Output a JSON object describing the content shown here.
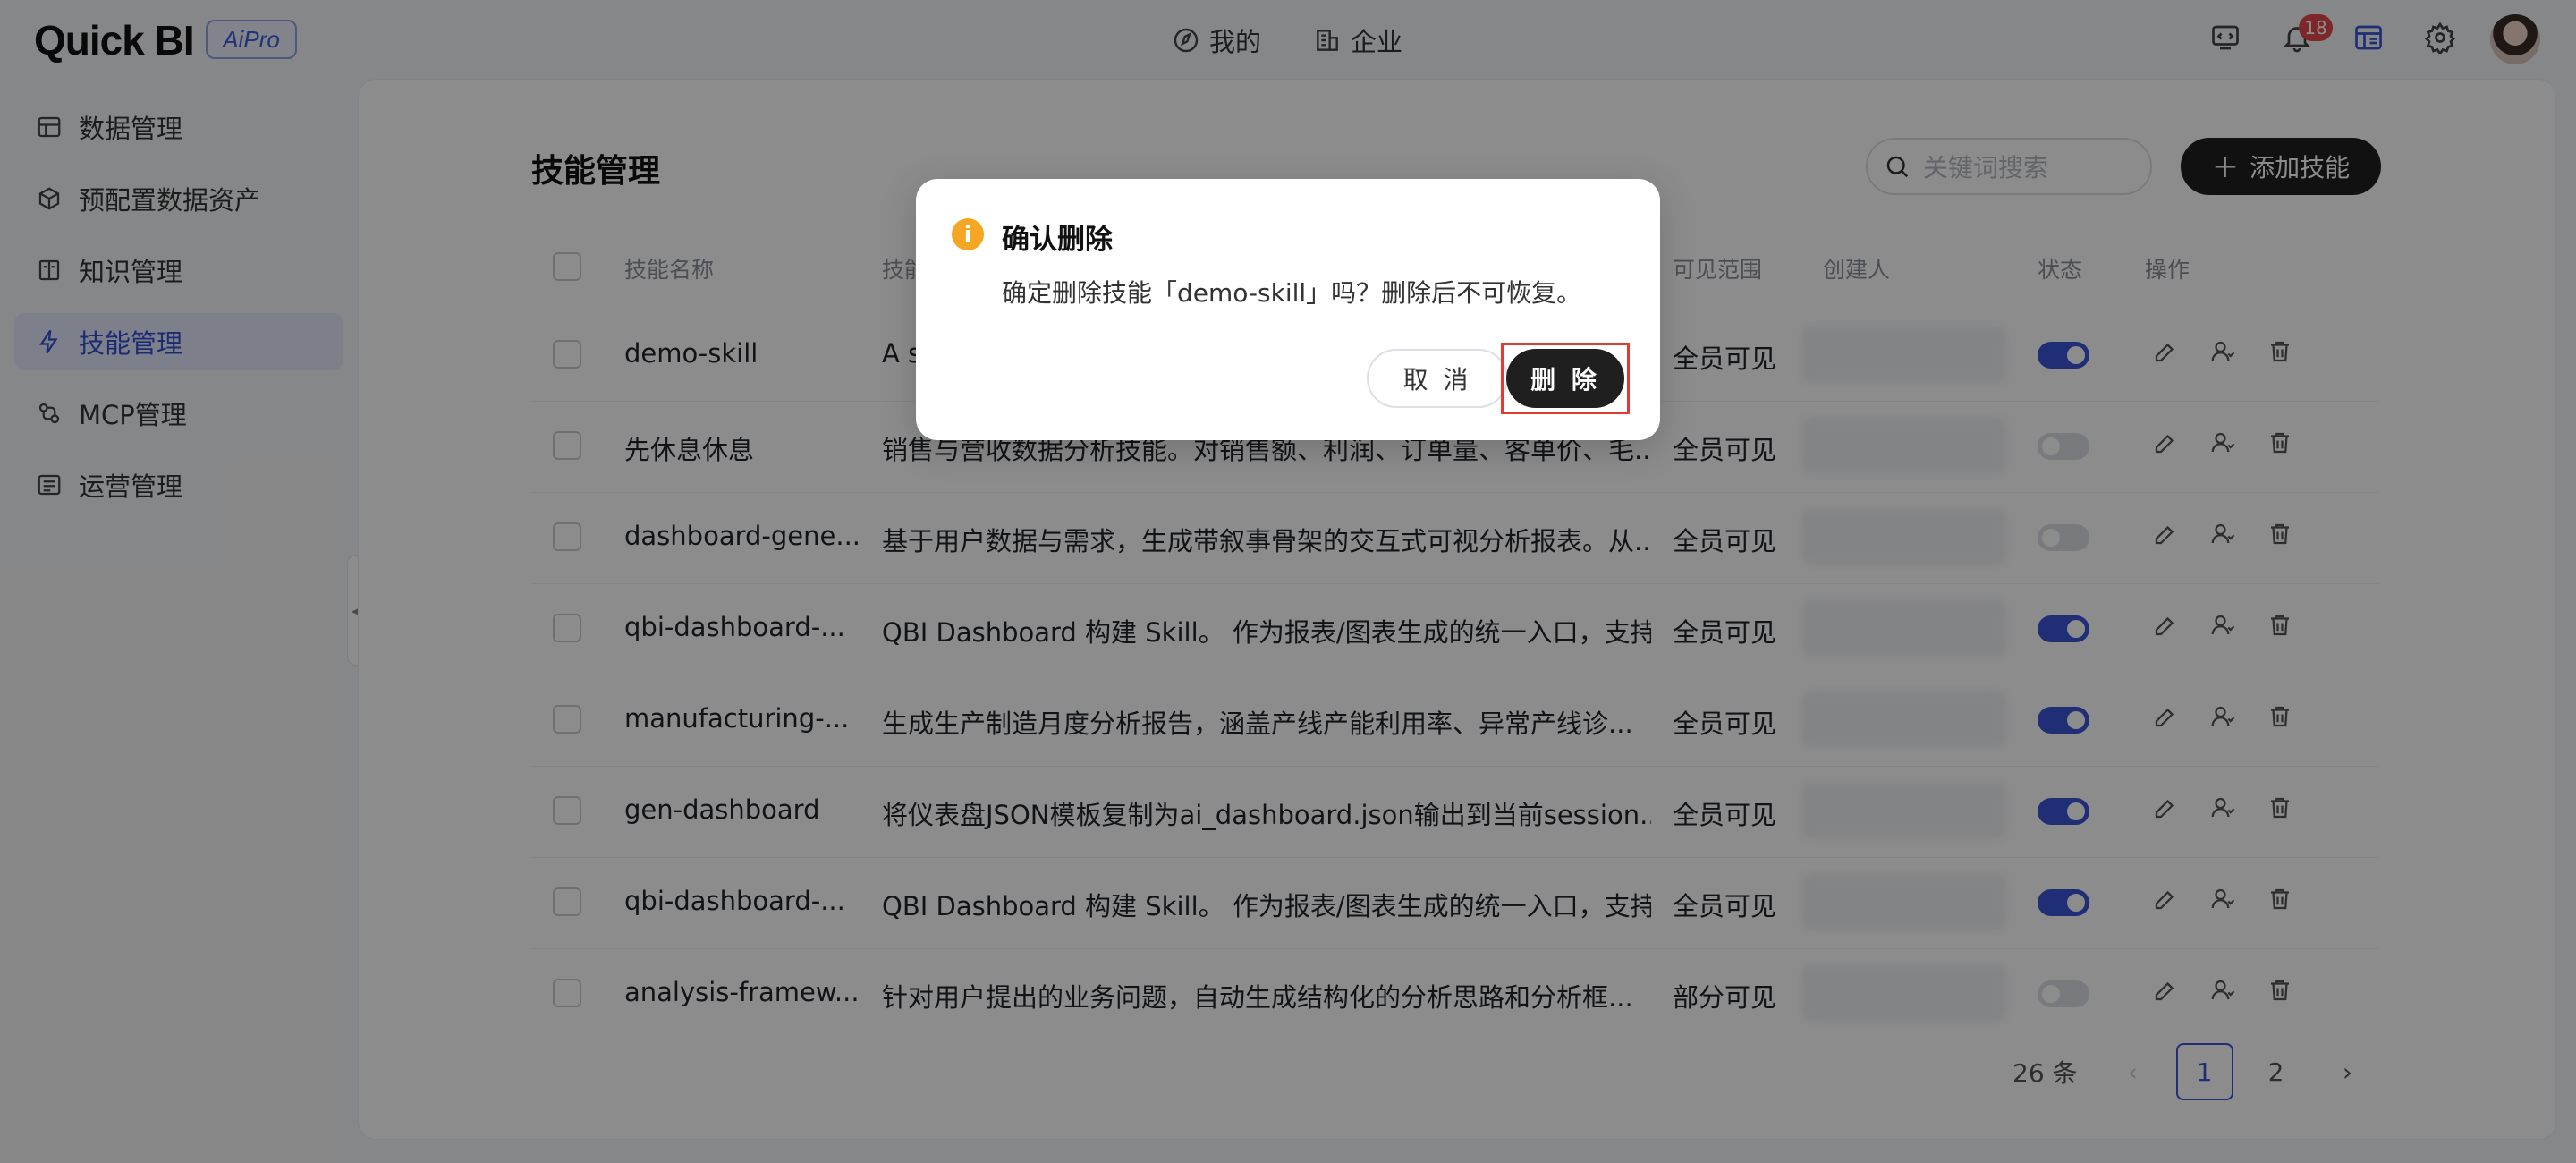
{
  "app": {
    "logo": "Quick BI",
    "badge": "AiPro"
  },
  "topnav": {
    "mine": "我的",
    "enterprise": "企业"
  },
  "notifications": {
    "count": "18"
  },
  "sidebar": {
    "items": [
      {
        "label": "数据管理",
        "icon": "data-table-icon"
      },
      {
        "label": "预配置数据资产",
        "icon": "cube-icon"
      },
      {
        "label": "知识管理",
        "icon": "book-icon"
      },
      {
        "label": "技能管理",
        "icon": "lightning-icon",
        "active": true
      },
      {
        "label": "MCP管理",
        "icon": "plug-icon"
      },
      {
        "label": "运营管理",
        "icon": "list-icon"
      }
    ]
  },
  "page": {
    "title": "技能管理",
    "search_placeholder": "关键词搜索",
    "add_button": "添加技能"
  },
  "table": {
    "headers": {
      "name": "技能名称",
      "desc": "技能描述",
      "scope": "可见范围",
      "creator": "创建人",
      "status": "状态",
      "actions": "操作"
    },
    "rows": [
      {
        "name": "demo-skill",
        "desc": "A s",
        "scope": "全员可见",
        "enabled": true
      },
      {
        "name": "先休息休息",
        "desc": "销售与营收数据分析技能。对销售额、利润、订单量、客单价、毛...",
        "scope": "全员可见",
        "enabled": false
      },
      {
        "name": "dashboard-gene...",
        "desc": "基于用户数据与需求，生成带叙事骨架的交互式可视分析报表。从...",
        "scope": "全员可见",
        "enabled": false
      },
      {
        "name": "qbi-dashboard-...",
        "desc": "QBI Dashboard 构建 Skill。 作为报表/图表生成的统一入口，支持...",
        "scope": "全员可见",
        "enabled": true
      },
      {
        "name": "manufacturing-...",
        "desc": "生成生产制造月度分析报告，涵盖产线产能利用率、异常产线诊...",
        "scope": "全员可见",
        "enabled": true
      },
      {
        "name": "gen-dashboard",
        "desc": "将仪表盘JSON模板复制为ai_dashboard.json输出到当前session...",
        "scope": "全员可见",
        "enabled": true
      },
      {
        "name": "qbi-dashboard-...",
        "desc": "QBI Dashboard 构建 Skill。 作为报表/图表生成的统一入口，支持...",
        "scope": "全员可见",
        "enabled": true
      },
      {
        "name": "analysis-framew...",
        "desc": "针对用户提出的业务问题，自动生成结构化的分析思路和分析框...",
        "scope": "部分可见",
        "enabled": false
      }
    ]
  },
  "pagination": {
    "total": "26 条",
    "pages": [
      "1",
      "2"
    ],
    "current": "1"
  },
  "dialog": {
    "icon_text": "i",
    "title": "确认删除",
    "message": "确定删除技能「demo-skill」吗？删除后不可恢复。",
    "cancel": "取 消",
    "confirm": "删 除"
  },
  "colors": {
    "accent": "#3a55d6",
    "danger_outline": "#e53935",
    "warning": "#f5a623",
    "primary_button": "#1f1f1f"
  }
}
